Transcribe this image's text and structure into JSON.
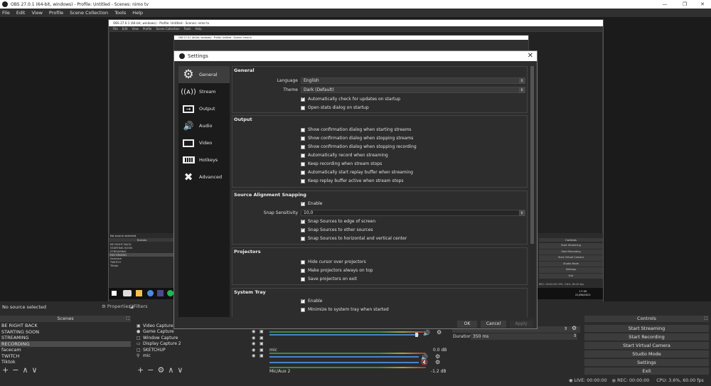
{
  "window": {
    "title": "OBS 27.0.1 (64-bit, windows) - Profile: Untitled - Scenes: nimo tv"
  },
  "menu": [
    "File",
    "Edit",
    "View",
    "Profile",
    "Scene Collection",
    "Tools",
    "Help"
  ],
  "nested": {
    "title": "OBS 27.0.1 (64-bit, windows) - Profile: Untitled - Scenes: nimo tv",
    "menu": [
      "File",
      "Edit",
      "View",
      "Profile",
      "Scene Collection",
      "Tools",
      "Help"
    ],
    "no_source": "No source selected",
    "scenes_header": "Scenes",
    "scenes": [
      "BE RIGHT BACK",
      "STARTING SOON",
      "STREAMING",
      "RECORDING",
      "facecam",
      "TWITCH",
      "Tiktok"
    ],
    "controls_header": "Controls",
    "controls": [
      "Start Streaming",
      "Start Recording",
      "Start Virtual Camera",
      "Studio Mode",
      "Settings",
      "Exit"
    ],
    "status": "REC: 00:00:00   CPU: 3.6%, 60.00 fps",
    "clock": "17:50",
    "date": "21/06/2021"
  },
  "dock": {
    "no_source": "No source selected",
    "properties": "Properties",
    "filters": "Filters",
    "scenes_header": "Scenes",
    "scenes": [
      {
        "name": "BE RIGHT BACK",
        "selected": false
      },
      {
        "name": "STARTING SOON",
        "selected": false
      },
      {
        "name": "STREAMING",
        "selected": false
      },
      {
        "name": "RECORDING",
        "selected": true
      },
      {
        "name": "facecam",
        "selected": false
      },
      {
        "name": "TWITCH",
        "selected": false
      },
      {
        "name": "Tiktok",
        "selected": false
      }
    ],
    "sources": [
      {
        "name": "Video Capture D",
        "icon": "camera-icon"
      },
      {
        "name": "Game Capture",
        "icon": "gamepad-icon"
      },
      {
        "name": "Window Capture",
        "icon": "window-icon"
      },
      {
        "name": "Display Capture 2",
        "icon": "monitor-icon"
      },
      {
        "name": "SKETCHUP",
        "icon": "window-icon"
      },
      {
        "name": "mic",
        "icon": "mic-icon"
      }
    ],
    "mixer": [
      {
        "name": "mic",
        "db": "0.0 dB",
        "muted": false
      },
      {
        "name": "Mic/Aux 2",
        "db": "-1.2 dB",
        "muted": true
      }
    ],
    "duration_label": "Duration",
    "duration_value": "350 ms",
    "controls_header": "Controls",
    "controls": [
      "Start Streaming",
      "Start Recording",
      "Start Virtual Camera",
      "Studio Mode",
      "Settings",
      "Exit"
    ],
    "status": {
      "live": "LIVE: 00:00:00",
      "rec": "REC: 00:00:00",
      "cpu": "CPU: 3.6%, 60.00 fps"
    }
  },
  "dialog": {
    "title": "Settings",
    "sidebar": [
      {
        "label": "General",
        "icon": "gear-icon",
        "selected": true
      },
      {
        "label": "Stream",
        "icon": "antenna-icon",
        "selected": false
      },
      {
        "label": "Output",
        "icon": "output-icon",
        "selected": false
      },
      {
        "label": "Audio",
        "icon": "speaker-icon",
        "selected": false
      },
      {
        "label": "Video",
        "icon": "monitor-icon",
        "selected": false
      },
      {
        "label": "Hotkeys",
        "icon": "keyboard-icon",
        "selected": false
      },
      {
        "label": "Advanced",
        "icon": "tools-icon",
        "selected": false
      }
    ],
    "general": {
      "title": "General",
      "language_label": "Language",
      "language_value": "English",
      "theme_label": "Theme",
      "theme_value": "Dark (Default)",
      "checks": [
        {
          "label": "Automatically check for updates on startup",
          "checked": true
        },
        {
          "label": "Open stats dialog on startup",
          "checked": false
        }
      ]
    },
    "output": {
      "title": "Output",
      "checks": [
        {
          "label": "Show confirmation dialog when starting streams",
          "checked": false
        },
        {
          "label": "Show confirmation dialog when stopping streams",
          "checked": false
        },
        {
          "label": "Show confirmation dialog when stopping recording",
          "checked": false
        },
        {
          "label": "Automatically record when streaming",
          "checked": false
        },
        {
          "label": "Keep recording when stream stops",
          "checked": false
        },
        {
          "label": "Automatically start replay buffer when streaming",
          "checked": false
        },
        {
          "label": "Keep replay buffer active when stream stops",
          "checked": false
        }
      ]
    },
    "snapping": {
      "title": "Source Alignment Snapping",
      "enable": {
        "label": "Enable",
        "checked": true
      },
      "sensitivity_label": "Snap Sensitivity",
      "sensitivity_value": "10,0",
      "checks": [
        {
          "label": "Snap Sources to edge of screen",
          "checked": true
        },
        {
          "label": "Snap Sources to other sources",
          "checked": true
        },
        {
          "label": "Snap Sources to horizontal and vertical center",
          "checked": false
        }
      ]
    },
    "projectors": {
      "title": "Projectors",
      "checks": [
        {
          "label": "Hide cursor over projectors",
          "checked": false
        },
        {
          "label": "Make projectors always on top",
          "checked": false
        },
        {
          "label": "Save projectors on exit",
          "checked": false
        }
      ]
    },
    "tray": {
      "title": "System Tray",
      "checks": [
        {
          "label": "Enable",
          "checked": true
        },
        {
          "label": "Minimize to system tray when started",
          "checked": false
        }
      ]
    },
    "buttons": {
      "ok": "OK",
      "cancel": "Cancel",
      "apply": "Apply"
    }
  }
}
